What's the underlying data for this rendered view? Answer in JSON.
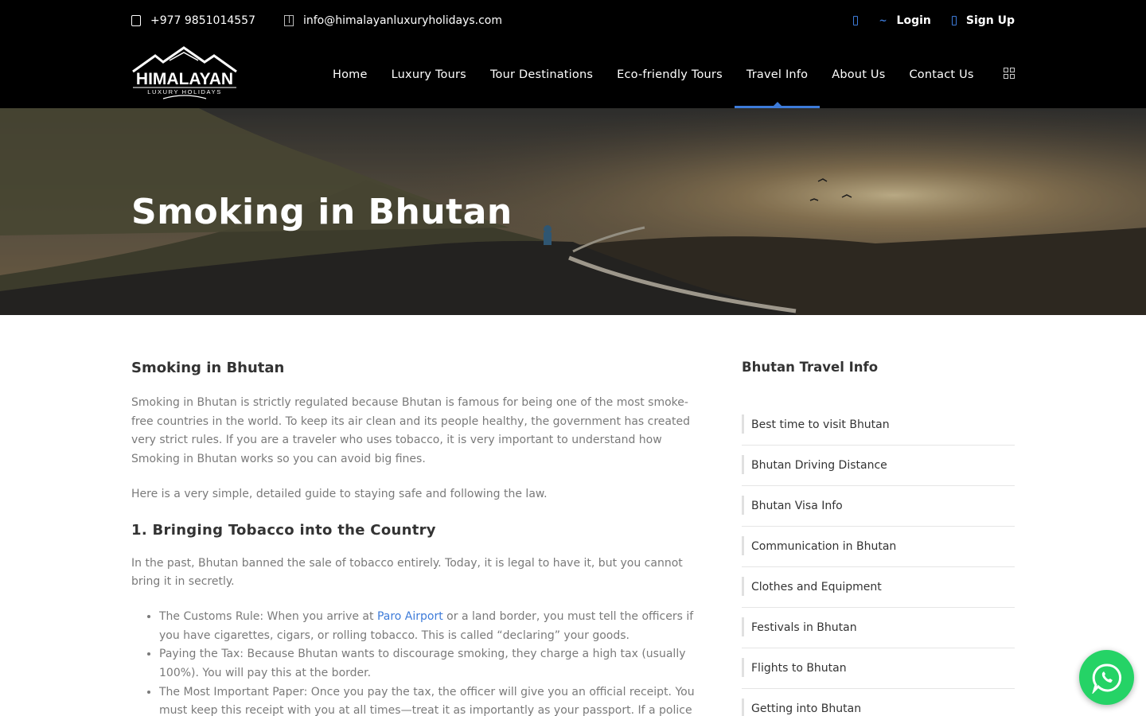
{
  "topbar": {
    "phone": "+977 9851014557",
    "email": "info@himalayanluxuryholidays.com",
    "login_label": "Login",
    "signup_label": "Sign Up"
  },
  "logo": {
    "title": "HIMALAYAN",
    "subtitle": "LUXURY HOLIDAYS"
  },
  "nav": {
    "items": [
      {
        "label": "Home"
      },
      {
        "label": "Luxury Tours"
      },
      {
        "label": "Tour Destinations"
      },
      {
        "label": "Eco-friendly Tours"
      },
      {
        "label": "Travel Info"
      },
      {
        "label": "About Us"
      },
      {
        "label": "Contact Us"
      }
    ],
    "active": "Travel Info"
  },
  "hero": {
    "title": "Smoking in Bhutan"
  },
  "article": {
    "heading": "Smoking in Bhutan",
    "intro": "Smoking in Bhutan is strictly regulated because Bhutan is famous for being one of the most smoke-free countries in the world. To keep its air clean and its people healthy, the government has created very strict rules. If you are a traveler who uses tobacco, it is very important to understand how Smoking in Bhutan works so you can avoid big fines.",
    "intro2": "Here is a very simple, detailed guide to staying safe and following the law.",
    "section1_heading": "1. Bringing Tobacco into the Country",
    "section1_para": "In the past, Bhutan banned the sale of tobacco entirely. Today, it is legal to have it, but you cannot bring it in secretly.",
    "bullets": {
      "b1_pre": "The Customs Rule: When you arrive at ",
      "b1_link": "Paro Airport",
      "b1_post": " or a land border, you must tell the officers if you have cigarettes, cigars, or rolling tobacco. This is called “declaring” your goods.",
      "b2": "Paying the Tax: Because Bhutan wants to discourage smoking, they charge a high tax (usually 100%). You will pay this at the border.",
      "b3": "The Most Important Paper: Once you pay the tax, the officer will give you an official receipt. You must keep this receipt with you at all times—treat it as importantly as your passport. If a police"
    }
  },
  "sidebar": {
    "title": "Bhutan Travel Info",
    "items": [
      {
        "label": "Best time to visit Bhutan"
      },
      {
        "label": "Bhutan Driving Distance"
      },
      {
        "label": "Bhutan Visa Info"
      },
      {
        "label": "Communication in Bhutan"
      },
      {
        "label": "Clothes and Equipment"
      },
      {
        "label": "Festivals in Bhutan"
      },
      {
        "label": "Flights to Bhutan"
      },
      {
        "label": "Getting into Bhutan"
      }
    ]
  },
  "icons": {
    "phone": "phone-icon",
    "email": "envelope-icon",
    "login": "login-icon",
    "signup": "user-icon",
    "menu": "grid-menu-icon",
    "whatsapp": "whatsapp-icon"
  },
  "colors": {
    "accent": "#3d7bd9",
    "topbar_bg": "#000000",
    "whatsapp": "#25d366"
  }
}
